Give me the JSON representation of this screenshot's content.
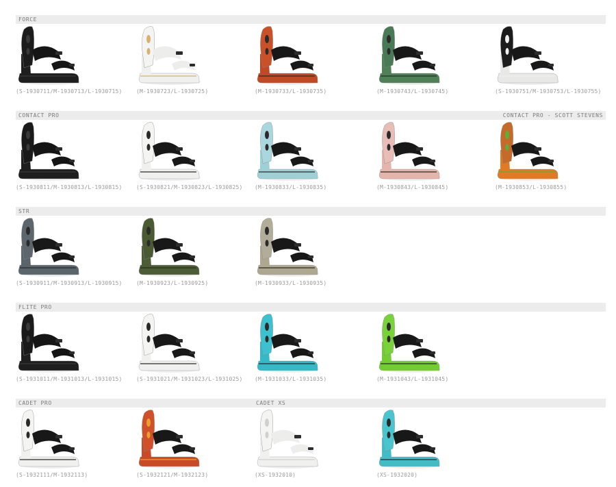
{
  "sections": [
    {
      "title": "FORCE",
      "title_right": "",
      "items": [
        {
          "sku": "(S-1930711/M-1930713/L-1930715)",
          "colors": {
            "high": "#1c1c1c",
            "strap": "#151515",
            "base": "#1e1e1e",
            "accent": "#3a3a3a"
          }
        },
        {
          "sku": "(M-1930723/L-1930725)",
          "colors": {
            "high": "#f4f4f2",
            "strap": "#ededeb",
            "base": "#f0f0ee",
            "accent": "#d8b070"
          }
        },
        {
          "sku": "(M-1930733/L-1930735)",
          "colors": {
            "high": "#c8512a",
            "strap": "#181818",
            "base": "#c04a25",
            "accent": "#2a2a2a"
          }
        },
        {
          "sku": "(M-1930743/L-1930745)",
          "colors": {
            "high": "#4a7a55",
            "strap": "#181818",
            "base": "#4f8057",
            "accent": "#2a2a2a"
          }
        },
        {
          "sku": "(S-1930751/M-1930753/L-1930755)",
          "colors": {
            "high": "#1c1c1c",
            "strap": "#181818",
            "base": "#e8e8e6",
            "accent": "#f0f0ee"
          }
        }
      ]
    },
    {
      "title": "CONTACT PRO",
      "title_right": "CONTACT PRO - SCOTT STEVENS",
      "items": [
        {
          "sku": "(S-1930811/M-1930813/L-1930815)",
          "colors": {
            "high": "#1a1a1a",
            "strap": "#151515",
            "base": "#1e1e1e",
            "accent": "#3a3a3a"
          }
        },
        {
          "sku": "(S-1930821/M-1930823/L-1930825)",
          "colors": {
            "high": "#f4f4f2",
            "strap": "#181818",
            "base": "#f0f0ee",
            "accent": "#2a2a2a"
          }
        },
        {
          "sku": "(M-1930833/L-1930835)",
          "colors": {
            "high": "#a9d7dd",
            "strap": "#181818",
            "base": "#9fd0d6",
            "accent": "#2a2a2a"
          }
        },
        {
          "sku": "(M-1930843/L-1930845)",
          "colors": {
            "high": "#e8bdb6",
            "strap": "#181818",
            "base": "#e4b4ad",
            "accent": "#2a2a2a"
          }
        },
        {
          "sku": "(M-1930853/L-1930855)",
          "colors": {
            "high": "#c46a2a",
            "strap": "#181818",
            "base": "#e07a25",
            "accent": "#5fae3a"
          }
        }
      ]
    },
    {
      "title": "STR",
      "title_right": "",
      "items": [
        {
          "sku": "(S-1930911/M-1930913/L-1930915)",
          "colors": {
            "high": "#5c666c",
            "strap": "#181818",
            "base": "#5a656b",
            "accent": "#2a2a2a"
          }
        },
        {
          "sku": "(M-1930923/L-1930925)",
          "colors": {
            "high": "#4a5a33",
            "strap": "#181818",
            "base": "#4c5c34",
            "accent": "#2a2a2a"
          }
        },
        {
          "sku": "(M-1930933/L-1930935)",
          "colors": {
            "high": "#b2ad98",
            "strap": "#181818",
            "base": "#aea891",
            "accent": "#2a2a2a"
          }
        }
      ]
    },
    {
      "title": "FLITE PRO",
      "title_right": "",
      "items": [
        {
          "sku": "(S-1931011/M-1931013/L-1931015)",
          "colors": {
            "high": "#1a1a1a",
            "strap": "#151515",
            "base": "#1e1e1e",
            "accent": "#3a3a3a"
          }
        },
        {
          "sku": "(S-1931021/M-1931023/L-1931025)",
          "colors": {
            "high": "#f4f4f2",
            "strap": "#181818",
            "base": "#f0f0ee",
            "accent": "#2a2a2a"
          }
        },
        {
          "sku": "(M-1931033/L-1931035)",
          "colors": {
            "high": "#3ec1cf",
            "strap": "#181818",
            "base": "#36b8c6",
            "accent": "#2a2a2a"
          }
        },
        {
          "sku": "(M-1931043/L-1931045)",
          "colors": {
            "high": "#7ad23a",
            "strap": "#181818",
            "base": "#74cc34",
            "accent": "#2a2a2a"
          }
        }
      ]
    },
    {
      "title": "CADET PRO",
      "title_right": "",
      "items": [
        {
          "sku": "(S-1932111/M-1932113)",
          "colors": {
            "high": "#f4f4f2",
            "strap": "#181818",
            "base": "#f0f0ee",
            "accent": "#2a2a2a"
          }
        },
        {
          "sku": "(S-1932121/M-1932123)",
          "colors": {
            "high": "#d0502a",
            "strap": "#181818",
            "base": "#c84a26",
            "accent": "#e8a030"
          }
        }
      ]
    },
    {
      "title": "CADET XS",
      "title_right": "",
      "items": [
        {
          "sku": "(XS-1932010)",
          "colors": {
            "high": "#f4f4f2",
            "strap": "#ededeb",
            "base": "#f0f0ee",
            "accent": "#d0d0d0"
          }
        },
        {
          "sku": "(XS-1932020)",
          "colors": {
            "high": "#4cc4ce",
            "strap": "#181818",
            "base": "#44bcc6",
            "accent": "#2a2a2a"
          }
        }
      ]
    }
  ]
}
